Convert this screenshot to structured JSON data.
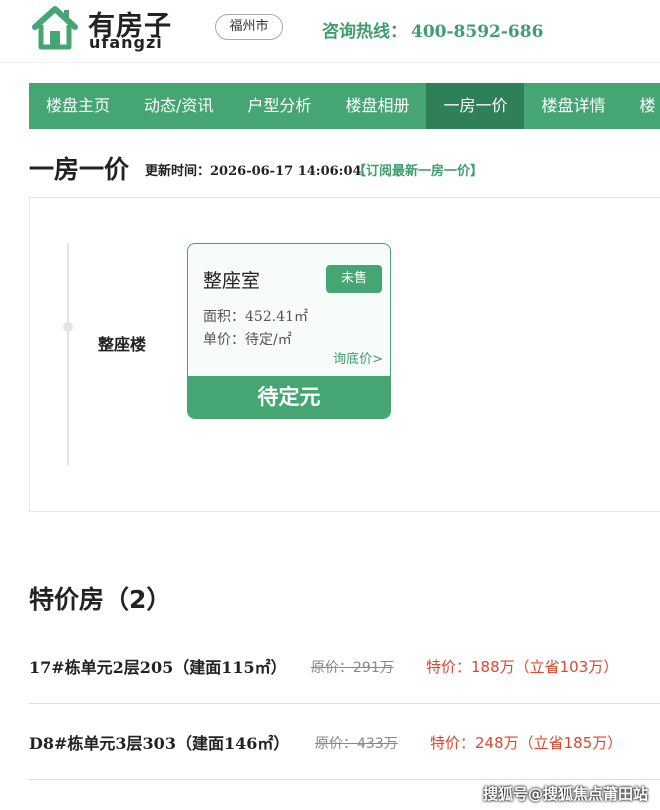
{
  "header": {
    "logo_title": "有房子",
    "logo_sub": "ufangzi",
    "city": "福州市",
    "hotline_label": "咨询热线：",
    "hotline_number": "400-8592-686"
  },
  "nav": {
    "items": [
      {
        "label": "楼盘主页"
      },
      {
        "label": "动态/资讯"
      },
      {
        "label": "户型分析"
      },
      {
        "label": "楼盘相册"
      },
      {
        "label": "一房一价",
        "active": true
      },
      {
        "label": "楼盘详情"
      },
      {
        "label": "楼"
      }
    ]
  },
  "price_section": {
    "title": "一房一价",
    "update_label": "更新时间：",
    "update_time": "2026-06-17 14:06:04",
    "subscribe": "【订阅最新一房一价】",
    "building": "整座楼",
    "card": {
      "title": "整座室",
      "status": "未售",
      "area_label": "面积：",
      "area_value": "452.41㎡",
      "unit_price_label": "单价：",
      "unit_price_value": "待定/㎡",
      "inquire": "询底价>",
      "total_price": "待定元"
    }
  },
  "special_section": {
    "title": "特价房（2）",
    "listings": [
      {
        "name": "17#栋单元2层205（建面115㎡）",
        "original": "原价：291万",
        "special": "特价：188万（立省103万）"
      },
      {
        "name": "D8#栋单元3层303（建面146㎡）",
        "original": "原价：433万",
        "special": "特价：248万（立省185万）"
      }
    ]
  },
  "watermark": "搜狐号@搜狐焦点莆田站",
  "colors": {
    "accent": "#45a673",
    "accent_dark": "#2f7f58",
    "price_red": "#e0452b"
  }
}
